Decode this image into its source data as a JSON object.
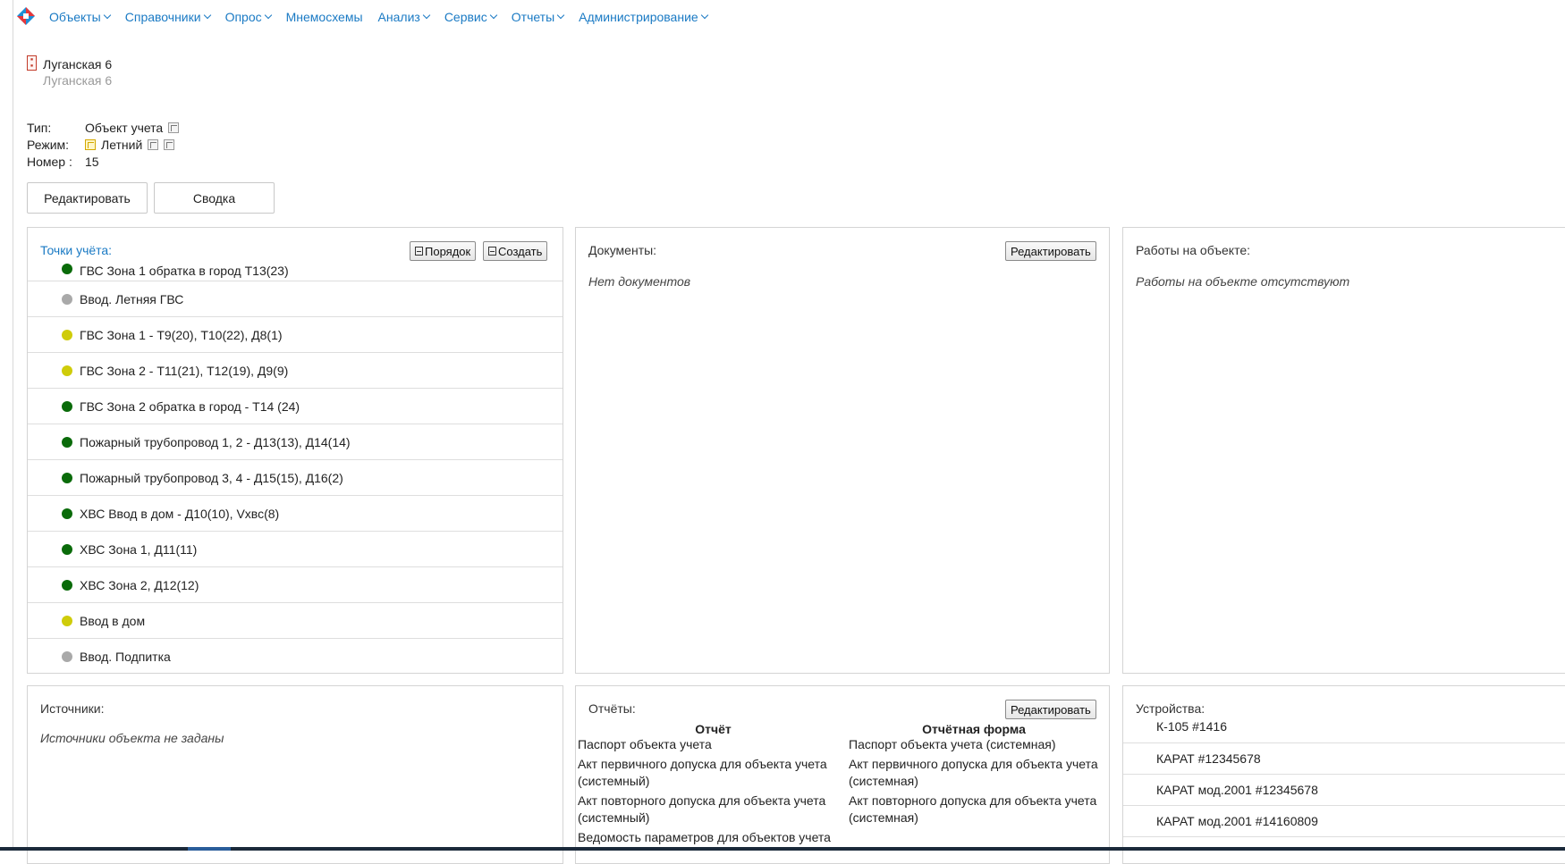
{
  "nav": {
    "items": [
      {
        "label": "Объекты",
        "dropdown": true
      },
      {
        "label": "Справочники",
        "dropdown": true
      },
      {
        "label": "Опрос",
        "dropdown": true
      },
      {
        "label": "Мнемосхемы",
        "dropdown": false
      },
      {
        "label": "Анализ",
        "dropdown": true
      },
      {
        "label": "Сервис",
        "dropdown": true
      },
      {
        "label": "Отчеты",
        "dropdown": true
      },
      {
        "label": "Администрирование",
        "dropdown": true
      }
    ]
  },
  "object": {
    "name": "Луганская 6",
    "subtitle": "Луганская 6",
    "type_label": "Тип:",
    "type_value": "Объект учета",
    "mode_label": "Режим:",
    "mode_value": "Летний",
    "number_label": "Номер :",
    "number_value": "15"
  },
  "actions": {
    "edit_label": "Редактировать",
    "summary_label": "Сводка"
  },
  "metering_points": {
    "title": "Точки учёта:",
    "order_label": "Порядок",
    "create_label": "Создать",
    "items": [
      {
        "label": "ГВС Зона 1 обратка в город Т13(23)",
        "status_color": "#0a6b0a"
      },
      {
        "label": "Ввод. Летняя ГВС",
        "status_color": "#a9a9a9"
      },
      {
        "label": "ГВС Зона 1 - Т9(20), Т10(22), Д8(1)",
        "status_color": "#cfcc0a"
      },
      {
        "label": "ГВС Зона 2 - Т11(21), Т12(19), Д9(9)",
        "status_color": "#cfcc0a"
      },
      {
        "label": "ГВС Зона 2 обратка в город - Т14 (24)",
        "status_color": "#0a6b0a"
      },
      {
        "label": "Пожарный трубопровод 1, 2 - Д13(13), Д14(14)",
        "status_color": "#0a6b0a"
      },
      {
        "label": "Пожарный трубопровод 3, 4 - Д15(15), Д16(2)",
        "status_color": "#0a6b0a"
      },
      {
        "label": "ХВС Ввод в дом - Д10(10), Vxвс(8)",
        "status_color": "#0a6b0a"
      },
      {
        "label": "ХВС Зона 1, Д11(11)",
        "status_color": "#0a6b0a"
      },
      {
        "label": "ХВС Зона 2, Д12(12)",
        "status_color": "#0a6b0a"
      },
      {
        "label": "Ввод в дом",
        "status_color": "#cfcc0a"
      },
      {
        "label": "Ввод. Подпитка",
        "status_color": "#a9a9a9"
      }
    ]
  },
  "documents": {
    "title": "Документы:",
    "edit_label": "Редактировать",
    "empty_text": "Нет документов"
  },
  "works": {
    "title": "Работы на объекте:",
    "empty_text": "Работы на объекте отсутствуют"
  },
  "sources": {
    "title": "Источники:",
    "empty_text": "Источники объекта не заданы"
  },
  "reports": {
    "title": "Отчёты:",
    "edit_label": "Редактировать",
    "col_report": "Отчёт",
    "col_form": "Отчётная форма",
    "rows": [
      {
        "report": "Паспорт объекта учета",
        "form": "Паспорт объекта учета (системная)"
      },
      {
        "report": "Акт первичного допуска для объекта учета (системный)",
        "form": "Акт первичного допуска для объекта учета (системная)"
      },
      {
        "report": "Акт повторного допуска для объекта учета (системный)",
        "form": "Акт повторного допуска для объекта учета (системная)"
      },
      {
        "report": "Ведомость параметров для объектов учета",
        "form": ""
      }
    ]
  },
  "devices": {
    "title": "Устройства:",
    "items": [
      {
        "label": "К-105 #1416"
      },
      {
        "label": "КАРАТ #12345678"
      },
      {
        "label": "КАРАТ мод.2001 #12345678"
      },
      {
        "label": "КАРАТ мод.2001 #14160809"
      }
    ]
  }
}
